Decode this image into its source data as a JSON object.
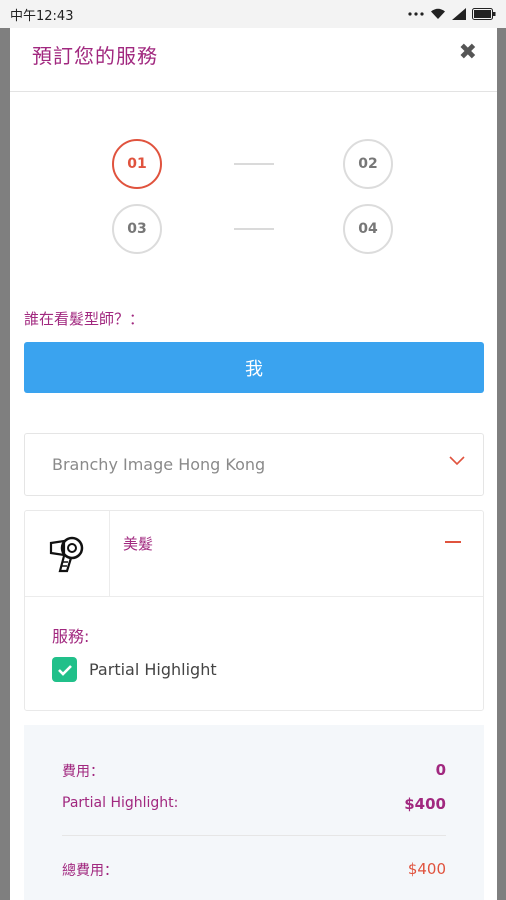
{
  "status_bar": {
    "time": "中午12:43",
    "icons": [
      "dots-icon",
      "wifi-icon",
      "signal-icon",
      "battery-icon"
    ]
  },
  "modal": {
    "title": "預訂您的服務",
    "close_icon": "close-icon"
  },
  "steps": [
    {
      "label": "01",
      "state": "active"
    },
    {
      "label": "02",
      "state": "inactive"
    },
    {
      "label": "03",
      "state": "inactive"
    },
    {
      "label": "04",
      "state": "inactive"
    }
  ],
  "who": {
    "label": "誰在看髮型師？：",
    "button_label": "我"
  },
  "branch": {
    "selected": "Branchy Image Hong Kong"
  },
  "service_card": {
    "category": "美髮",
    "category_icon": "hair-dryer-icon",
    "services_label": "服務:",
    "service_name": "Partial Highlight",
    "service_checked": true
  },
  "summary": {
    "fee_label": "費用：",
    "fee_value": "0",
    "item_label": "Partial Highlight:",
    "item_value": "$400",
    "total_label": "總費用：",
    "total_value": "$400"
  },
  "colors": {
    "accent_purple": "#a1287f",
    "accent_red": "#e0533e",
    "button_blue": "#3aa3ef",
    "check_green": "#21c08a"
  }
}
